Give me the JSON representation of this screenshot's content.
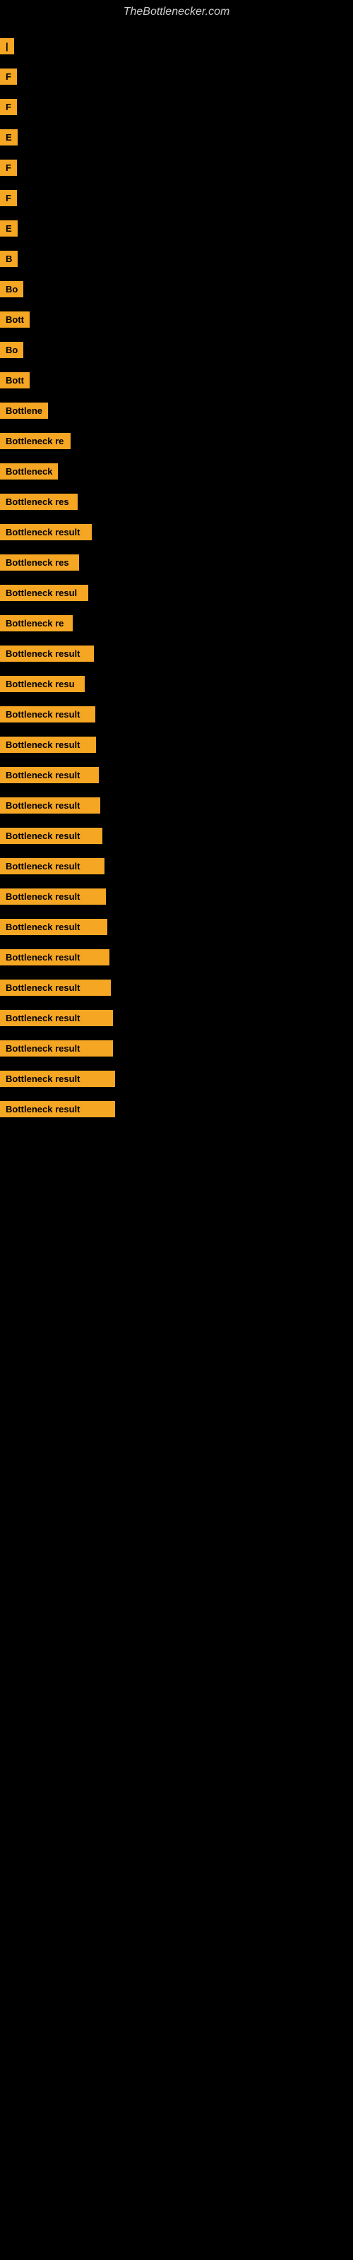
{
  "site": {
    "title": "TheBottlenecker.com"
  },
  "items": [
    {
      "id": 1,
      "label": "|",
      "width": 8
    },
    {
      "id": 2,
      "label": "F",
      "width": 10
    },
    {
      "id": 3,
      "label": "F",
      "width": 10
    },
    {
      "id": 4,
      "label": "E",
      "width": 12
    },
    {
      "id": 5,
      "label": "F",
      "width": 12
    },
    {
      "id": 6,
      "label": "F",
      "width": 12
    },
    {
      "id": 7,
      "label": "E",
      "width": 14
    },
    {
      "id": 8,
      "label": "B",
      "width": 18
    },
    {
      "id": 9,
      "label": "Bo",
      "width": 22
    },
    {
      "id": 10,
      "label": "Bott",
      "width": 30
    },
    {
      "id": 11,
      "label": "Bo",
      "width": 26
    },
    {
      "id": 12,
      "label": "Bott",
      "width": 34
    },
    {
      "id": 13,
      "label": "Bottlene",
      "width": 62
    },
    {
      "id": 14,
      "label": "Bottleneck re",
      "width": 100
    },
    {
      "id": 15,
      "label": "Bottleneck",
      "width": 80
    },
    {
      "id": 16,
      "label": "Bottleneck res",
      "width": 110
    },
    {
      "id": 17,
      "label": "Bottleneck result",
      "width": 130
    },
    {
      "id": 18,
      "label": "Bottleneck res",
      "width": 112
    },
    {
      "id": 19,
      "label": "Bottleneck resul",
      "width": 125
    },
    {
      "id": 20,
      "label": "Bottleneck re",
      "width": 103
    },
    {
      "id": 21,
      "label": "Bottleneck result",
      "width": 133
    },
    {
      "id": 22,
      "label": "Bottleneck resu",
      "width": 120
    },
    {
      "id": 23,
      "label": "Bottleneck result",
      "width": 135
    },
    {
      "id": 24,
      "label": "Bottleneck result",
      "width": 136
    },
    {
      "id": 25,
      "label": "Bottleneck result",
      "width": 140
    },
    {
      "id": 26,
      "label": "Bottleneck result",
      "width": 142
    },
    {
      "id": 27,
      "label": "Bottleneck result",
      "width": 145
    },
    {
      "id": 28,
      "label": "Bottleneck result",
      "width": 148
    },
    {
      "id": 29,
      "label": "Bottleneck result",
      "width": 150
    },
    {
      "id": 30,
      "label": "Bottleneck result",
      "width": 152
    },
    {
      "id": 31,
      "label": "Bottleneck result",
      "width": 155
    },
    {
      "id": 32,
      "label": "Bottleneck result",
      "width": 157
    },
    {
      "id": 33,
      "label": "Bottleneck result",
      "width": 160
    },
    {
      "id": 34,
      "label": "Bottleneck result",
      "width": 160
    },
    {
      "id": 35,
      "label": "Bottleneck result",
      "width": 163
    },
    {
      "id": 36,
      "label": "Bottleneck result",
      "width": 163
    }
  ]
}
